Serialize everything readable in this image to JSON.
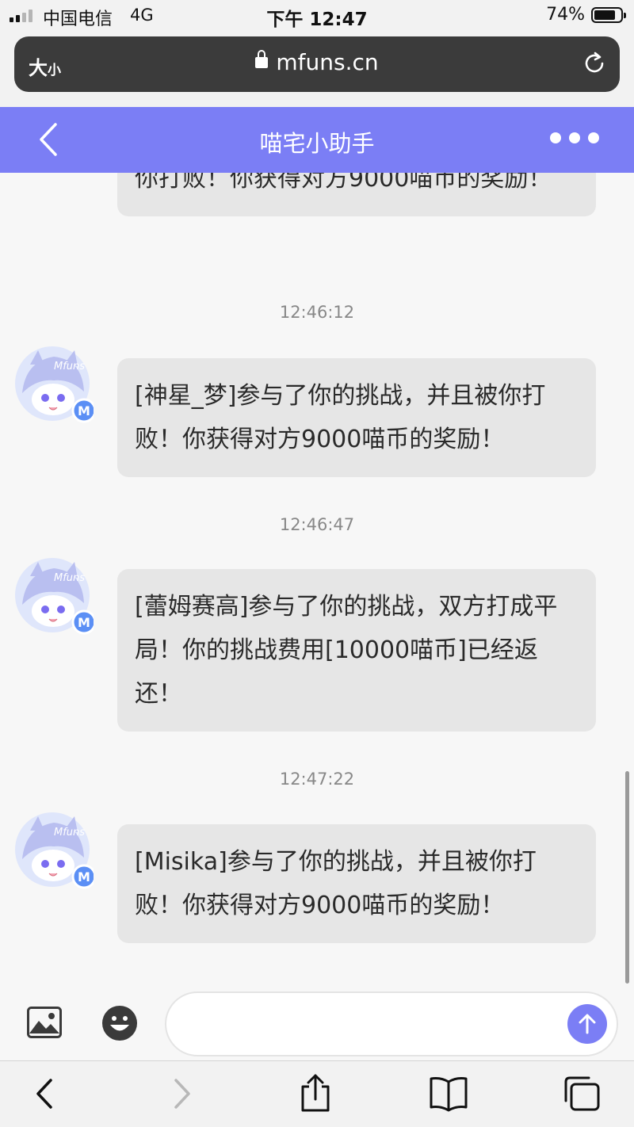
{
  "status_bar": {
    "carrier": "中国电信",
    "network": "4G",
    "time": "下午 12:47",
    "battery": "74%"
  },
  "browser": {
    "text_size_big": "大",
    "text_size_small": "小",
    "url": "mfuns.cn"
  },
  "chat": {
    "title": "喵宅小助手",
    "messages": [
      {
        "text": "你打败！你获得对方9000喵币的奖励！",
        "partial": true
      },
      {
        "time": "12:46:12",
        "text": "[神星_梦]参与了你的挑战，并且被你打败！你获得对方9000喵币的奖励！"
      },
      {
        "time": "12:46:47",
        "text": "[蕾姆赛高]参与了你的挑战，双方打成平局！你的挑战费用[10000喵币]已经返还！"
      },
      {
        "time": "12:47:22",
        "text": "[Misika]参与了你的挑战，并且被你打败！你获得对方9000喵币的奖励！"
      }
    ],
    "avatar_label": "Mfuns",
    "avatar_badge": "M"
  },
  "input": {
    "placeholder": ""
  },
  "icons": {
    "back": "chevron-left-icon",
    "more": "more-dots-icon",
    "image": "image-icon",
    "emoji": "emoji-icon",
    "send": "arrow-up-icon",
    "share": "share-icon",
    "bookmarks": "book-icon",
    "tabs": "tabs-icon"
  },
  "colors": {
    "header": "#7b7ef5",
    "bubble": "#e6e6e6",
    "send_button": "#7b7ef5"
  }
}
